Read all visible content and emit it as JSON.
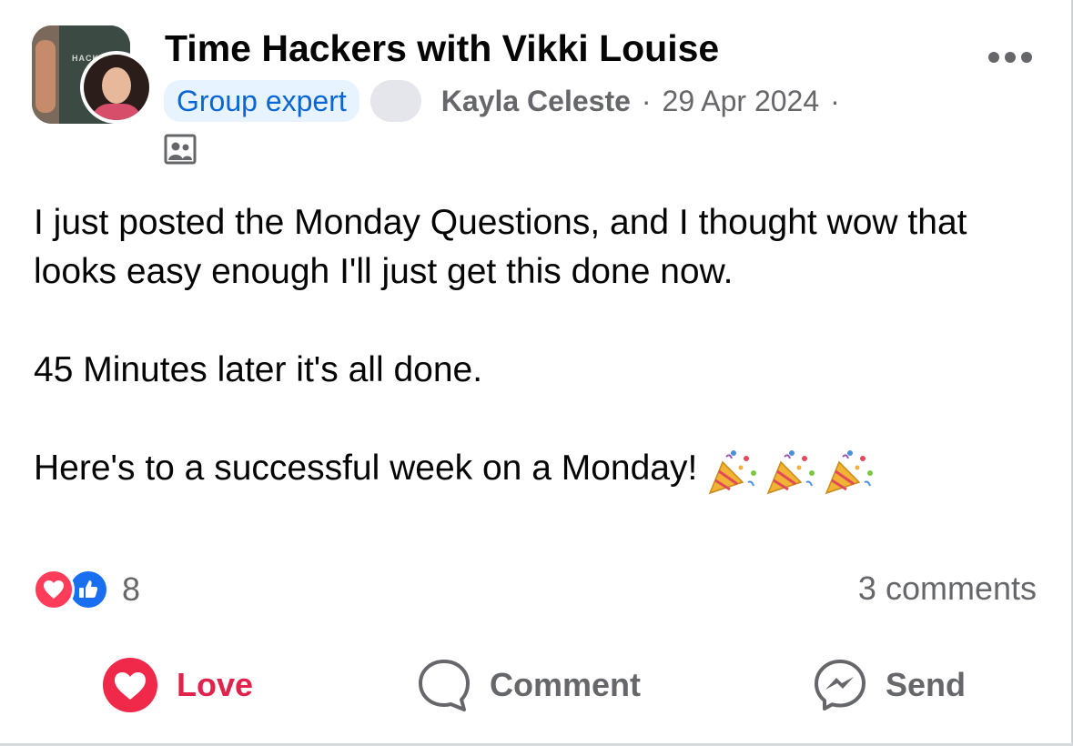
{
  "post": {
    "group_name": "Time Hackers with Vikki Louise",
    "group_avatar_text": "HACK",
    "badge": "Group expert",
    "author": "Kayla Celeste",
    "separator": "·",
    "date": "29 Apr 2024",
    "audience_icon": "group-members-icon",
    "body": {
      "paragraph_1": "I just posted the Monday Questions, and I thought wow that looks easy enough I'll just get this done now.",
      "paragraph_2": "45 Minutes later it's all done.",
      "paragraph_3": "Here's to a successful week on a Monday!",
      "emoji": [
        "party-popper",
        "party-popper",
        "party-popper"
      ]
    },
    "reactions": {
      "types": [
        "love",
        "like"
      ],
      "count": "8"
    },
    "comments_label": "3 comments",
    "actions": {
      "love": "Love",
      "comment": "Comment",
      "send": "Send"
    }
  },
  "colors": {
    "love_red": "#e0234c",
    "like_blue": "#1a6ff0",
    "badge_blue": "#0866d6",
    "secondary_text": "#65676b"
  }
}
